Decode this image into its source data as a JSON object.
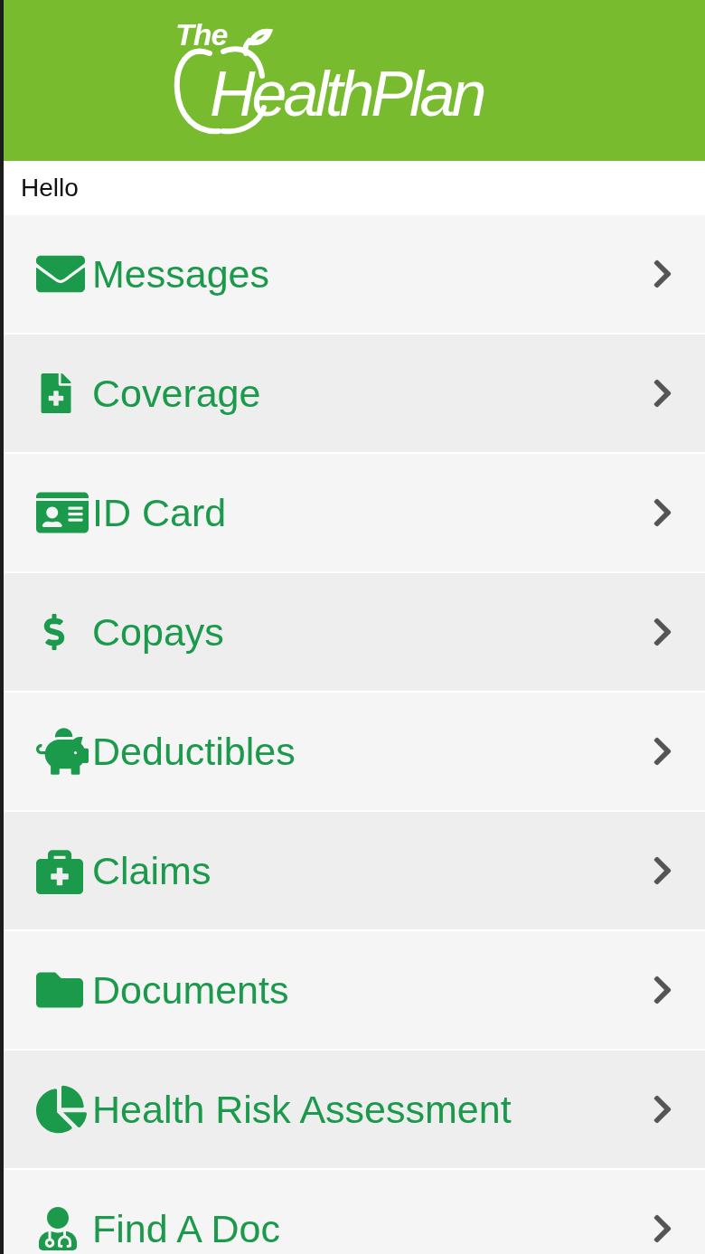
{
  "header": {
    "logo_small": "The",
    "logo_large": "HealthPlan"
  },
  "greeting": "Hello",
  "menu": [
    {
      "label": "Messages",
      "kind": "envelope"
    },
    {
      "label": "Coverage",
      "kind": "clipboard"
    },
    {
      "label": "ID Card",
      "kind": "idcard"
    },
    {
      "label": "Copays",
      "kind": "dollar"
    },
    {
      "label": "Deductibles",
      "kind": "piggy"
    },
    {
      "label": "Claims",
      "kind": "medkit"
    },
    {
      "label": "Documents",
      "kind": "folder"
    },
    {
      "label": "Health Risk Assessment",
      "kind": "pie"
    },
    {
      "label": "Find A Doc",
      "kind": "doctor"
    }
  ]
}
